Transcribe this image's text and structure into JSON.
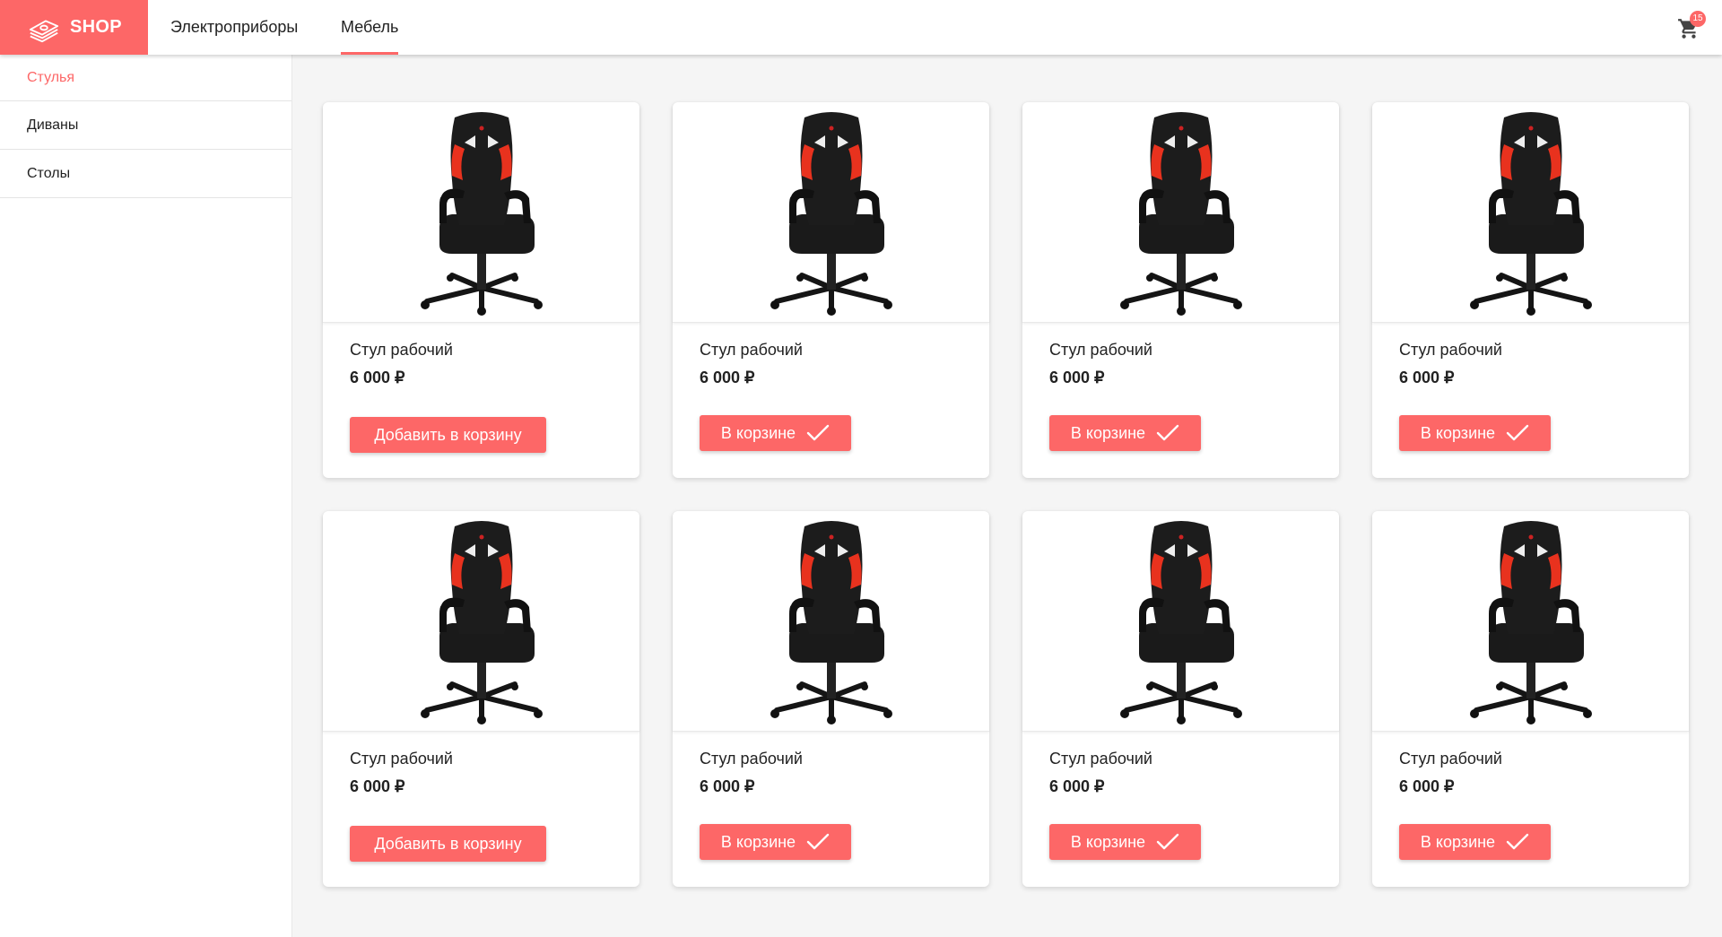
{
  "app": {
    "logo_text": "SHOP",
    "cart_count": "15",
    "accent": "#fd6767"
  },
  "nav": {
    "tabs": [
      {
        "label": "Электроприборы"
      },
      {
        "label": "Мебель",
        "active": true
      }
    ]
  },
  "sidebar": {
    "items": [
      {
        "label": "Стулья",
        "active": true
      },
      {
        "label": "Диваны"
      },
      {
        "label": "Столы"
      }
    ]
  },
  "products": [
    {
      "title": "Стул рабочий",
      "price": "6 000 ₽",
      "button": "Добавить в корзину",
      "in_cart": false
    },
    {
      "title": "Стул рабочий",
      "price": "6 000 ₽",
      "button": "В корзине",
      "in_cart": true
    },
    {
      "title": "Стул рабочий",
      "price": "6 000 ₽",
      "button": "В корзине",
      "in_cart": true
    },
    {
      "title": "Стул рабочий",
      "price": "6 000 ₽",
      "button": "В корзине",
      "in_cart": true
    },
    {
      "title": "Стул рабочий",
      "price": "6 000 ₽",
      "button": "Добавить в корзину",
      "in_cart": false
    },
    {
      "title": "Стул рабочий",
      "price": "6 000 ₽",
      "button": "В корзине",
      "in_cart": true
    },
    {
      "title": "Стул рабочий",
      "price": "6 000 ₽",
      "button": "В корзине",
      "in_cart": true
    },
    {
      "title": "Стул рабочий",
      "price": "6 000 ₽",
      "button": "В корзине",
      "in_cart": true
    }
  ],
  "icons": {
    "logo": "money-stack-icon",
    "cart": "shopping-cart-icon",
    "check": "check-icon",
    "product_image": "office-chair-image"
  }
}
